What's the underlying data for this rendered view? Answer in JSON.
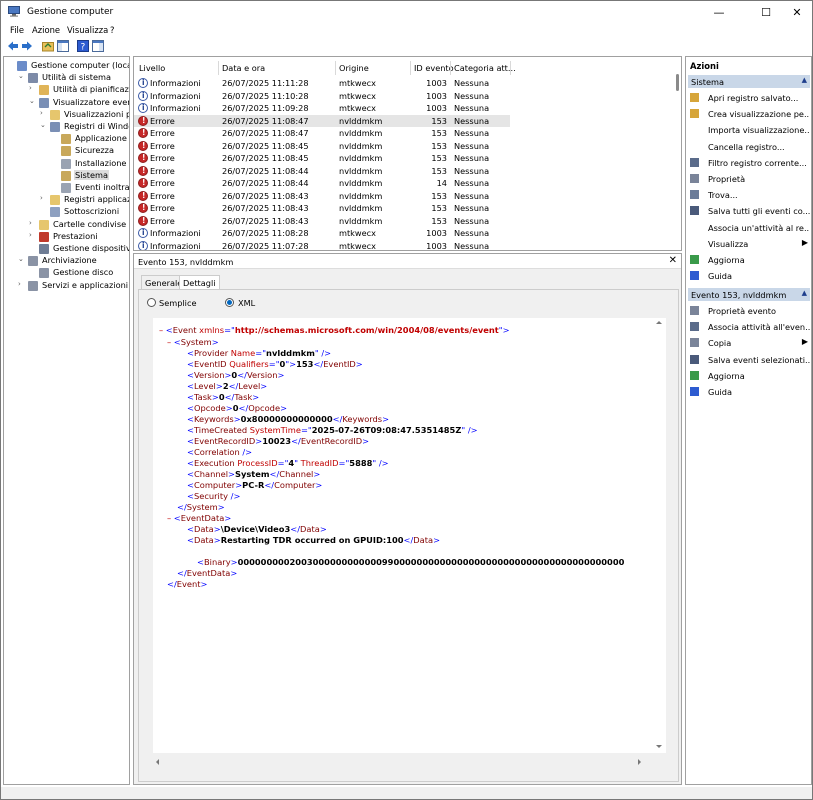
{
  "window": {
    "title": "Gestione computer",
    "minimize": "—",
    "maximize": "☐",
    "close": "✕"
  },
  "menu": [
    "File",
    "Azione",
    "Visualizza",
    "?"
  ],
  "tree": [
    {
      "label": "Gestione computer (locale)",
      "level": 0,
      "exp": "",
      "icon": "#6b8cc9"
    },
    {
      "label": "Utilità di sistema",
      "level": 1,
      "exp": "⌄",
      "icon": "#7d8ba8"
    },
    {
      "label": "Utilità di pianificazione",
      "level": 2,
      "exp": "›",
      "icon": "#e0b458"
    },
    {
      "label": "Visualizzatore eventi",
      "level": 2,
      "exp": "⌄",
      "icon": "#7a8fb5"
    },
    {
      "label": "Visualizzazioni perso",
      "level": 3,
      "exp": "›",
      "icon": "#e6c66d"
    },
    {
      "label": "Registri di Windows",
      "level": 3,
      "exp": "⌄",
      "icon": "#7a8fb5"
    },
    {
      "label": "Applicazione",
      "level": 4,
      "exp": "",
      "icon": "#c8a85b"
    },
    {
      "label": "Sicurezza",
      "level": 4,
      "exp": "",
      "icon": "#c8a85b"
    },
    {
      "label": "Installazione",
      "level": 4,
      "exp": "",
      "icon": "#9aa3b2"
    },
    {
      "label": "Sistema",
      "level": 4,
      "exp": "",
      "icon": "#c8a85b",
      "selected": true
    },
    {
      "label": "Eventi inoltrati",
      "level": 4,
      "exp": "",
      "icon": "#9aa3b2"
    },
    {
      "label": "Registri applicazioni",
      "level": 3,
      "exp": "›",
      "icon": "#e6c66d"
    },
    {
      "label": "Sottoscrizioni",
      "level": 3,
      "exp": "",
      "icon": "#8ea0c0"
    },
    {
      "label": "Cartelle condivise",
      "level": 2,
      "exp": "›",
      "icon": "#e6c66d"
    },
    {
      "label": "Prestazioni",
      "level": 2,
      "exp": "›",
      "icon": "#c0392b"
    },
    {
      "label": "Gestione dispositivi",
      "level": 2,
      "exp": "",
      "icon": "#6f7d95"
    },
    {
      "label": "Archiviazione",
      "level": 1,
      "exp": "⌄",
      "icon": "#8a93a5"
    },
    {
      "label": "Gestione disco",
      "level": 2,
      "exp": "",
      "icon": "#8a93a5"
    },
    {
      "label": "Servizi e applicazioni",
      "level": 1,
      "exp": "›",
      "icon": "#8a93a5"
    }
  ],
  "list": {
    "columns": [
      "Livello",
      "Data e ora",
      "Origine",
      "ID evento",
      "Categoria att..."
    ],
    "rows": [
      {
        "level": "Informazioni",
        "type": "info",
        "date": "26/07/2025 11:11:28",
        "source": "mtkwecx",
        "id": "1003",
        "cat": "Nessuna"
      },
      {
        "level": "Informazioni",
        "type": "info",
        "date": "26/07/2025 11:10:28",
        "source": "mtkwecx",
        "id": "1003",
        "cat": "Nessuna"
      },
      {
        "level": "Informazioni",
        "type": "info",
        "date": "26/07/2025 11:09:28",
        "source": "mtkwecx",
        "id": "1003",
        "cat": "Nessuna"
      },
      {
        "level": "Errore",
        "type": "err",
        "date": "26/07/2025 11:08:47",
        "source": "nvlddmkm",
        "id": "153",
        "cat": "Nessuna",
        "selected": true
      },
      {
        "level": "Errore",
        "type": "err",
        "date": "26/07/2025 11:08:47",
        "source": "nvlddmkm",
        "id": "153",
        "cat": "Nessuna"
      },
      {
        "level": "Errore",
        "type": "err",
        "date": "26/07/2025 11:08:45",
        "source": "nvlddmkm",
        "id": "153",
        "cat": "Nessuna"
      },
      {
        "level": "Errore",
        "type": "err",
        "date": "26/07/2025 11:08:45",
        "source": "nvlddmkm",
        "id": "153",
        "cat": "Nessuna"
      },
      {
        "level": "Errore",
        "type": "err",
        "date": "26/07/2025 11:08:44",
        "source": "nvlddmkm",
        "id": "153",
        "cat": "Nessuna"
      },
      {
        "level": "Errore",
        "type": "err",
        "date": "26/07/2025 11:08:44",
        "source": "nvlddmkm",
        "id": "14",
        "cat": "Nessuna"
      },
      {
        "level": "Errore",
        "type": "err",
        "date": "26/07/2025 11:08:43",
        "source": "nvlddmkm",
        "id": "153",
        "cat": "Nessuna"
      },
      {
        "level": "Errore",
        "type": "err",
        "date": "26/07/2025 11:08:43",
        "source": "nvlddmkm",
        "id": "153",
        "cat": "Nessuna"
      },
      {
        "level": "Errore",
        "type": "err",
        "date": "26/07/2025 11:08:43",
        "source": "nvlddmkm",
        "id": "153",
        "cat": "Nessuna"
      },
      {
        "level": "Informazioni",
        "type": "info",
        "date": "26/07/2025 11:08:28",
        "source": "mtkwecx",
        "id": "1003",
        "cat": "Nessuna"
      },
      {
        "level": "Informazioni",
        "type": "info",
        "date": "26/07/2025 11:07:28",
        "source": "mtkwecx",
        "id": "1003",
        "cat": "Nessuna"
      }
    ]
  },
  "detail": {
    "title": "Evento 153, nvlddmkm",
    "close": "✕",
    "tabs": [
      "Generale",
      "Dettagli"
    ],
    "radio_simple": "Semplice",
    "radio_xml": "XML"
  },
  "xml": {
    "ev_open": "Event",
    "ev_attr": "xmlns",
    "ev_val": "http://schemas.microsoft.com/win/2004/08/events/event",
    "system": "System",
    "provider_tag": "Provider",
    "provider_attr": "Name",
    "provider_val": "nvlddmkm",
    "eventid_tag": "EventID",
    "eventid_attr": "Qualifiers",
    "eventid_q": "0",
    "eventid_val": "153",
    "version_tag": "Version",
    "version_val": "0",
    "level_tag": "Level",
    "level_val": "2",
    "task_tag": "Task",
    "task_val": "0",
    "opcode_tag": "Opcode",
    "opcode_val": "0",
    "keywords_tag": "Keywords",
    "keywords_val": "0x80000000000000",
    "tc_tag": "TimeCreated",
    "tc_attr": "SystemTime",
    "tc_val": "2025-07-26T09:08:47.5351485Z",
    "erid_tag": "EventRecordID",
    "erid_val": "10023",
    "corr_tag": "Correlation",
    "exec_tag": "Execution",
    "exec_attr1": "ProcessID",
    "exec_val1": "4",
    "exec_attr2": "ThreadID",
    "exec_val2": "5888",
    "channel_tag": "Channel",
    "channel_val": "System",
    "computer_tag": "Computer",
    "computer_val": "PC-R",
    "security_tag": "Security",
    "eventdata": "EventData",
    "data_tag": "Data",
    "data1": "\\Device\\Video3",
    "data2": "Restarting TDR occurred on GPUID:100",
    "binary_tag": "Binary",
    "binary_val": "0000000002003000000000000990000000000000000000000000000000000000000"
  },
  "actions": {
    "header": "Azioni",
    "section1": "Sistema",
    "items1": [
      {
        "label": "Apri registro salvato...",
        "icon": "#d6a53a"
      },
      {
        "label": "Crea visualizzazione pe...",
        "icon": "#d6a53a"
      },
      {
        "label": "Importa visualizzazione...",
        "icon": ""
      },
      {
        "label": "Cancella registro...",
        "icon": ""
      },
      {
        "label": "Filtro registro corrente...",
        "icon": "#5a6b8a"
      },
      {
        "label": "Proprietà",
        "icon": "#7a8499"
      },
      {
        "label": "Trova...",
        "icon": "#6b7c99"
      },
      {
        "label": "Salva tutti gli eventi co...",
        "icon": "#4a5a7a"
      },
      {
        "label": "Associa un'attività al re...",
        "icon": ""
      },
      {
        "label": "Visualizza",
        "icon": "",
        "sub": "▶"
      },
      {
        "label": "Aggiorna",
        "icon": "#3a9a4a"
      },
      {
        "label": "Guida",
        "icon": "#2d5bd0"
      }
    ],
    "section2": "Evento 153, nvlddmkm",
    "items2": [
      {
        "label": "Proprietà evento",
        "icon": "#7a8499"
      },
      {
        "label": "Associa attività all'even...",
        "icon": "#5a6b8a"
      },
      {
        "label": "Copia",
        "icon": "#7a8499",
        "sub": "▶"
      },
      {
        "label": "Salva eventi selezionati...",
        "icon": "#4a5a7a"
      },
      {
        "label": "Aggiorna",
        "icon": "#3a9a4a"
      },
      {
        "label": "Guida",
        "icon": "#2d5bd0"
      }
    ]
  }
}
